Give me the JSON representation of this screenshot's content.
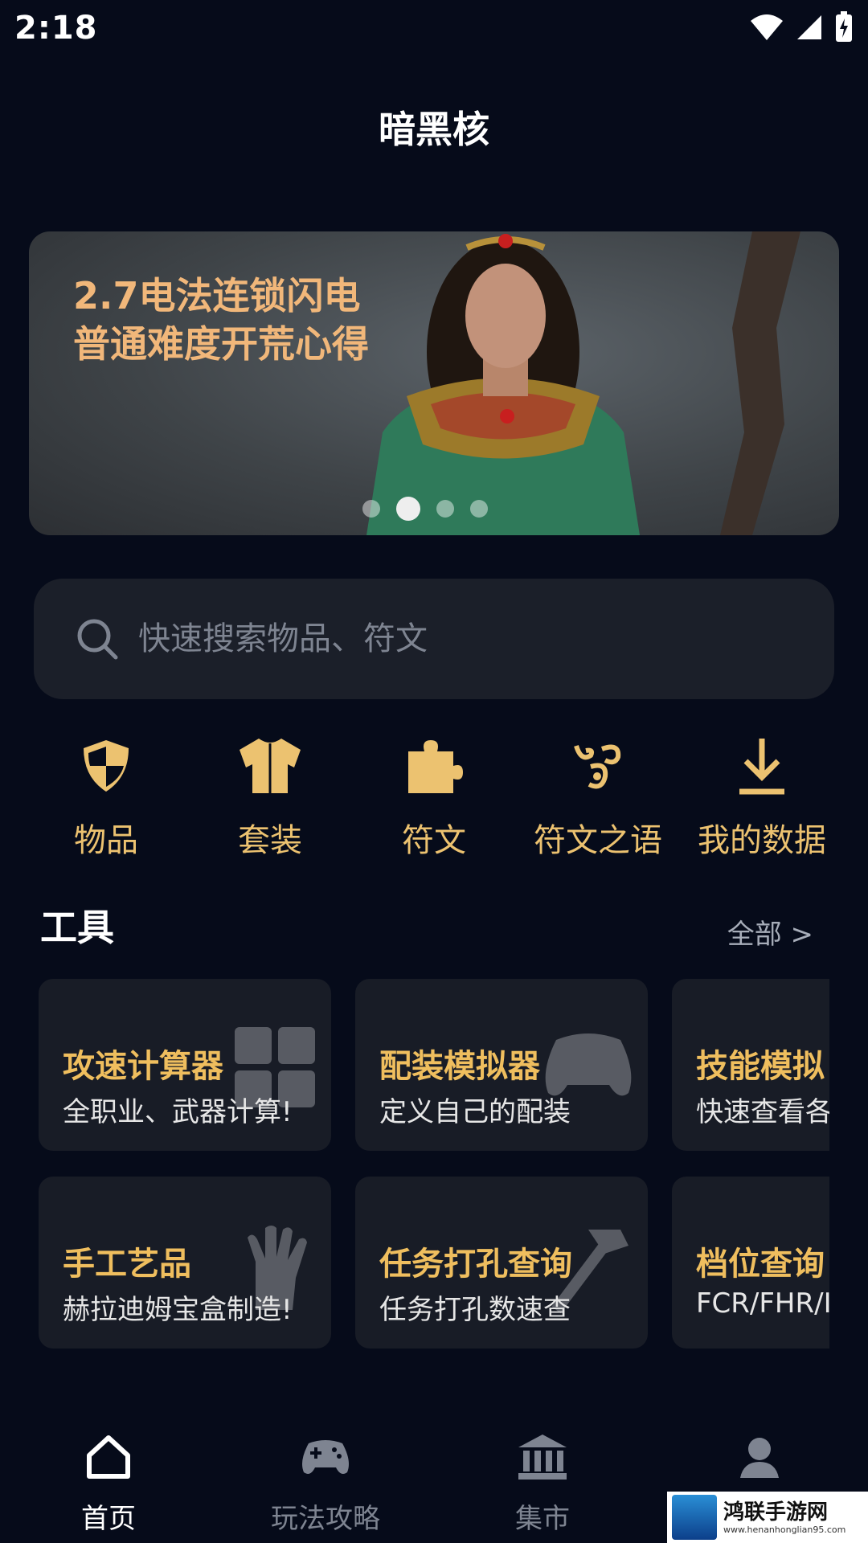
{
  "status": {
    "time": "2:18"
  },
  "app": {
    "title": "暗黑核"
  },
  "banner": {
    "line1": "2.7电法连锁闪电",
    "line2": "普通难度开荒心得",
    "dots": 4,
    "active_dot": 2
  },
  "search": {
    "placeholder": "快速搜索物品、符文",
    "icon": "search-icon"
  },
  "categories": [
    {
      "label": "物品",
      "icon": "shield-icon"
    },
    {
      "label": "套装",
      "icon": "shirt-icon"
    },
    {
      "label": "符文",
      "icon": "puzzle-icon"
    },
    {
      "label": "符文之语",
      "icon": "rune-symbol-icon"
    },
    {
      "label": "我的数据",
      "icon": "download-icon"
    }
  ],
  "tools": {
    "title": "工具",
    "see_all": "全部 >",
    "items": [
      {
        "title": "攻速计算器",
        "subtitle": "全职业、武器计算!",
        "icon": "calculator-icon"
      },
      {
        "title": "配装模拟器",
        "subtitle": "定义自己的配装",
        "icon": "gamepad-icon"
      },
      {
        "title": "技能模拟",
        "subtitle": "快速查看各",
        "icon": "skill-icon"
      },
      {
        "title": "手工艺品",
        "subtitle": "赫拉迪姆宝盒制造!",
        "icon": "hand-icon"
      },
      {
        "title": "任务打孔查询",
        "subtitle": "任务打孔数速查",
        "icon": "hammer-icon"
      },
      {
        "title": "档位查询",
        "subtitle": "FCR/FHR/I",
        "icon": "gauge-icon"
      }
    ]
  },
  "tabbar": [
    {
      "label": "首页",
      "icon": "home-icon",
      "active": true
    },
    {
      "label": "玩法攻略",
      "icon": "gamepad-icon",
      "active": false
    },
    {
      "label": "集市",
      "icon": "market-icon",
      "active": false
    },
    {
      "label": "",
      "icon": "profile-icon",
      "active": false
    }
  ],
  "watermark": {
    "name": "鸿联手游网",
    "url": "www.henanhonglian95.com"
  },
  "colors": {
    "accent": "#ecc270",
    "background": "#060b1a",
    "card": "#181c26"
  }
}
